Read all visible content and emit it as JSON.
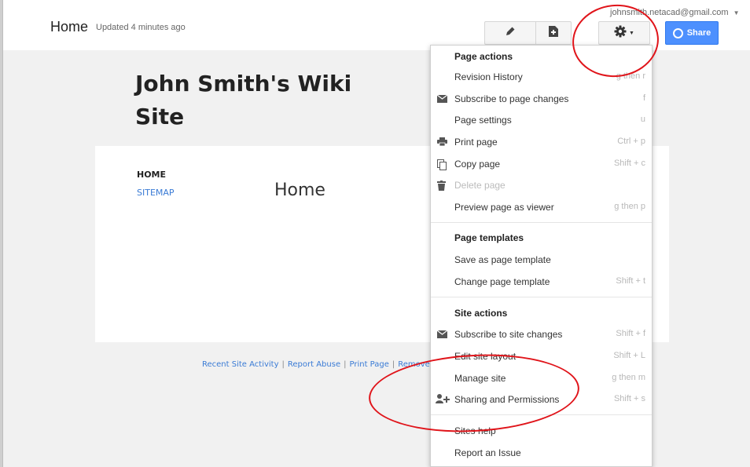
{
  "topbar": {
    "page_name": "Home",
    "updated": "Updated 4 minutes ago",
    "account_email": "johnsmith.netacad@gmail.com",
    "share_label": "Share"
  },
  "site": {
    "title": "John Smith's Wiki Site",
    "nav": [
      "HOME",
      "SITEMAP"
    ],
    "content_heading": "Home"
  },
  "footer": {
    "links": [
      "Recent Site Activity",
      "Report Abuse",
      "Print Page",
      "Remove"
    ]
  },
  "menu": {
    "page_actions": {
      "title": "Page actions",
      "items": [
        {
          "label": "Revision History",
          "shortcut": "g then r"
        },
        {
          "label": "Subscribe to page changes",
          "shortcut": "f",
          "icon": "envelope-icon"
        },
        {
          "label": "Page settings",
          "shortcut": "u"
        },
        {
          "label": "Print page",
          "shortcut": "Ctrl + p",
          "icon": "printer-icon"
        },
        {
          "label": "Copy page",
          "shortcut": "Shift + c",
          "icon": "copy-icon"
        },
        {
          "label": "Delete page",
          "shortcut": "",
          "icon": "trash-icon",
          "disabled": true
        },
        {
          "label": "Preview page as viewer",
          "shortcut": "g then p"
        }
      ]
    },
    "page_templates": {
      "title": "Page templates",
      "items": [
        {
          "label": "Save as page template",
          "shortcut": ""
        },
        {
          "label": "Change page template",
          "shortcut": "Shift + t"
        }
      ]
    },
    "site_actions": {
      "title": "Site actions",
      "items": [
        {
          "label": "Subscribe to site changes",
          "shortcut": "Shift + f",
          "icon": "envelope-icon"
        },
        {
          "label": "Edit site layout",
          "shortcut": "Shift + L"
        },
        {
          "label": "Manage site",
          "shortcut": "g then m"
        },
        {
          "label": "Sharing and Permissions",
          "shortcut": "Shift + s",
          "icon": "add-person-icon"
        }
      ]
    },
    "help": {
      "items": [
        {
          "label": "Sites help"
        },
        {
          "label": "Report an Issue"
        }
      ]
    }
  },
  "colors": {
    "share_blue": "#4d90fe",
    "link_blue": "#3a7bd5",
    "annotation_red": "#e0141a"
  }
}
